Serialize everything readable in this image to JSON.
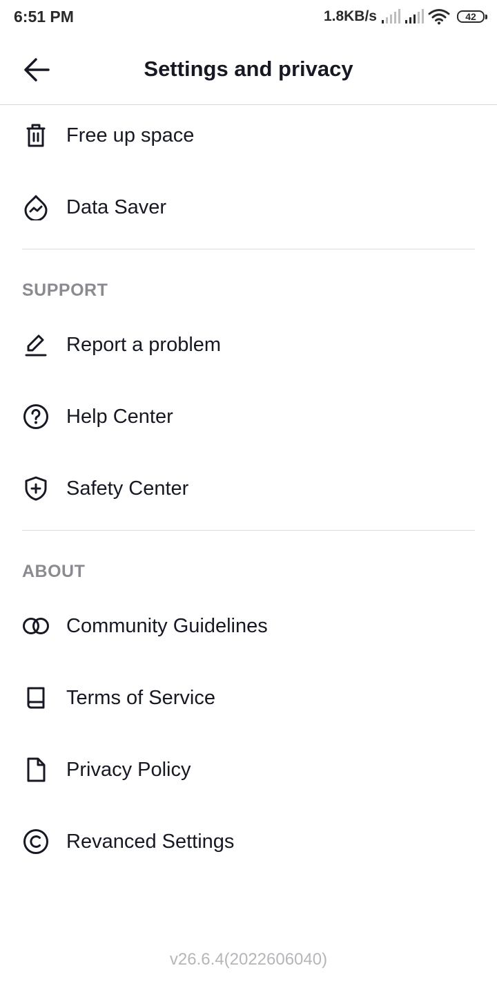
{
  "status_bar": {
    "time": "6:51 PM",
    "net_speed": "1.8KB/s",
    "battery_level": "42"
  },
  "header": {
    "title": "Settings and privacy",
    "back_icon": "arrow-left-icon"
  },
  "cache_items": [
    {
      "label": "Free up space",
      "icon": "trash-icon"
    },
    {
      "label": "Data Saver",
      "icon": "data-drop-icon"
    }
  ],
  "support": {
    "heading": "SUPPORT",
    "items": [
      {
        "label": "Report a problem",
        "icon": "pencil-icon"
      },
      {
        "label": "Help Center",
        "icon": "question-circle-icon"
      },
      {
        "label": "Safety Center",
        "icon": "shield-plus-icon"
      }
    ]
  },
  "about": {
    "heading": "ABOUT",
    "items": [
      {
        "label": "Community Guidelines",
        "icon": "interlocking-circles-icon"
      },
      {
        "label": "Terms of Service",
        "icon": "book-icon"
      },
      {
        "label": "Privacy Policy",
        "icon": "document-icon"
      },
      {
        "label": "Revanced Settings",
        "icon": "copyright-icon"
      }
    ]
  },
  "version": "v26.6.4(2022606040)",
  "colors": {
    "text_primary": "#161823",
    "section_header": "#8a8b91",
    "divider": "#dcdcdf",
    "version_text": "#b5b6ba",
    "background": "#ffffff"
  }
}
